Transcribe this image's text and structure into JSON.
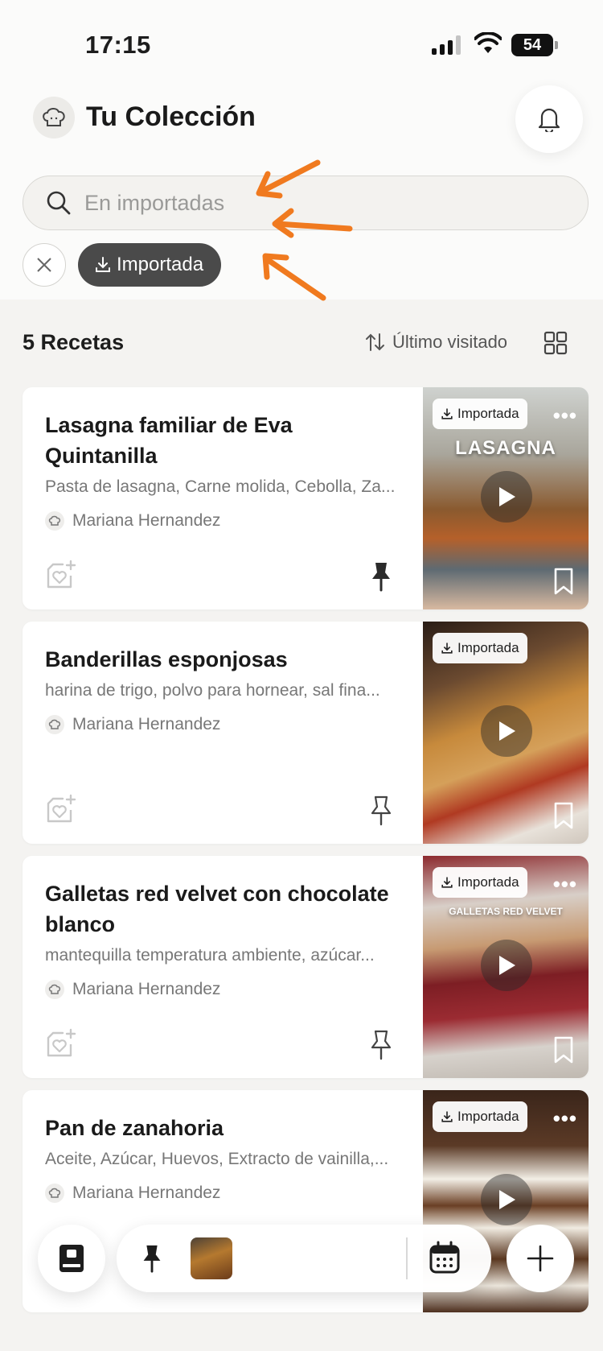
{
  "status": {
    "time": "17:15",
    "battery": "54"
  },
  "header": {
    "title": "Tu Colección"
  },
  "search": {
    "placeholder": "En importadas"
  },
  "filter": {
    "chip_label": "Importada"
  },
  "list": {
    "count_label": "5 Recetas",
    "sort_label": "Último visitado"
  },
  "recipes": [
    {
      "title": "Lasagna familiar de Eva Quintanilla",
      "ingredients": "Pasta de lasagna, Carne molida, Cebolla, Za...",
      "author": "Mariana Hernandez",
      "badge": "Importada",
      "caption": "LASAGNA",
      "pinned": true
    },
    {
      "title": "Banderillas esponjosas",
      "ingredients": "harina de trigo, polvo para hornear, sal fina...",
      "author": "Mariana Hernandez",
      "badge": "Importada",
      "caption": "",
      "pinned": false
    },
    {
      "title": "Galletas red velvet con chocolate blanco",
      "ingredients": "mantequilla temperatura ambiente, azúcar...",
      "author": "Mariana Hernandez",
      "badge": "Importada",
      "caption": "GALLETAS RED VELVET",
      "pinned": false
    },
    {
      "title": "Pan de zanahoria",
      "ingredients": "Aceite, Azúcar, Huevos, Extracto de vainilla,...",
      "author": "Mariana Hernandez",
      "badge": "Importada",
      "caption": "",
      "pinned": false
    }
  ],
  "colors": {
    "accent_arrow": "#f07a1f",
    "chip_bg": "#4a4a4a",
    "background": "#f4f3f1"
  }
}
